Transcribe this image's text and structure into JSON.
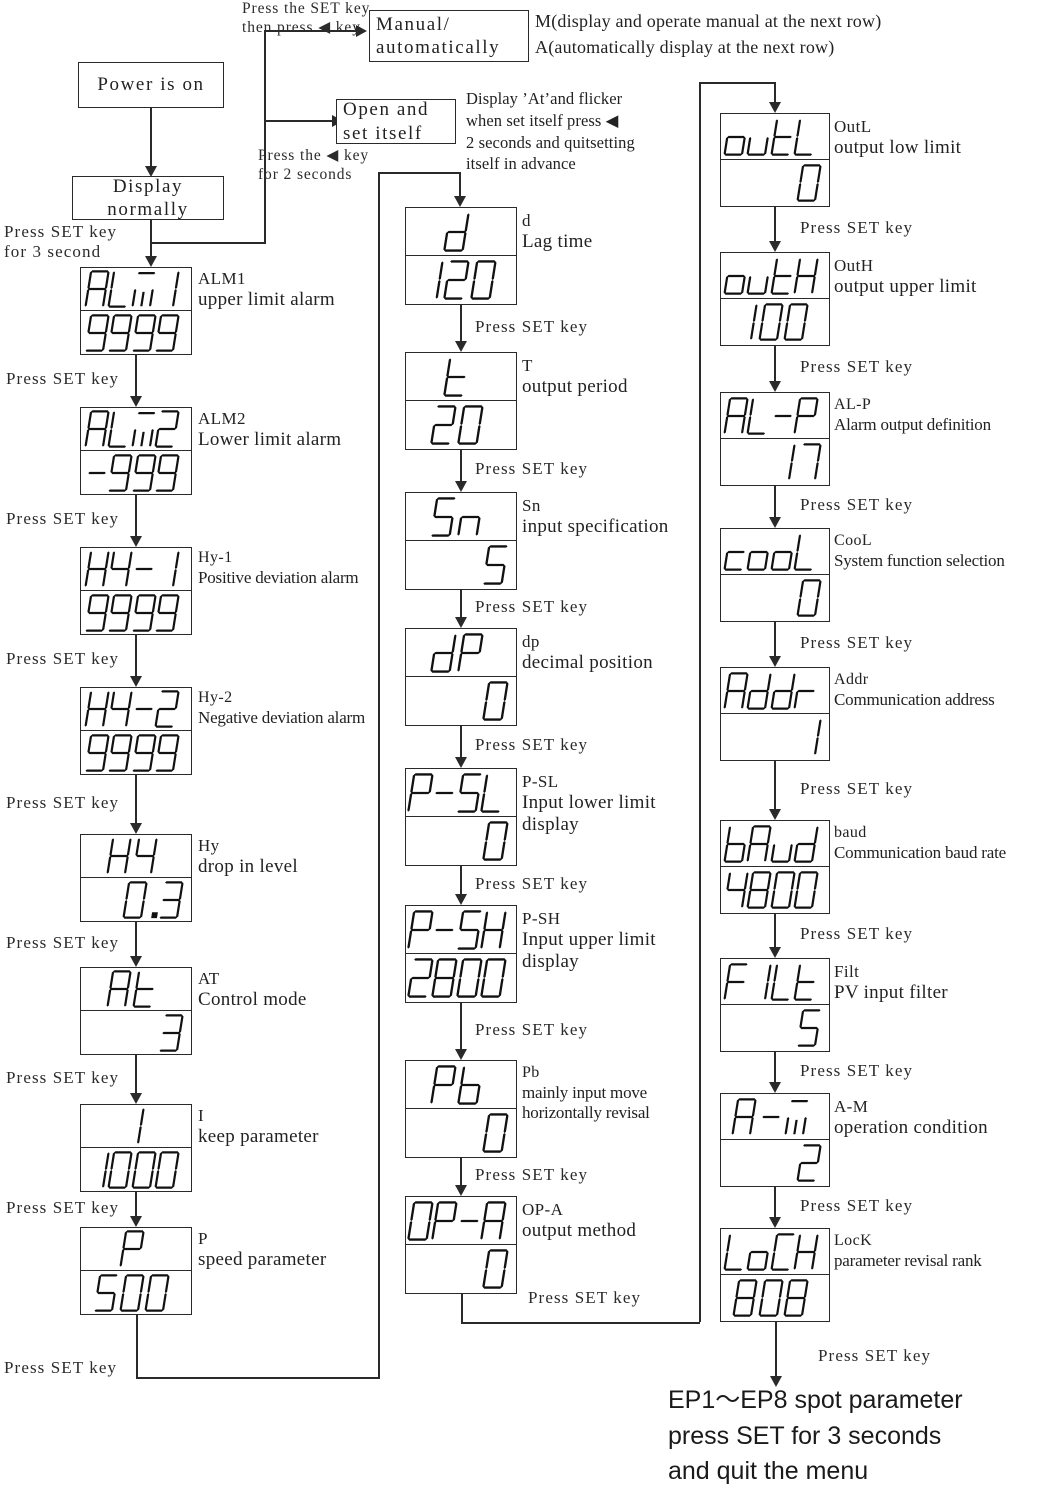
{
  "flow": {
    "start_box": "Power is on",
    "normal_box": "Display normally",
    "manual_box": "Manual/\nautomatically",
    "selfset_box": "Open and\nset itself",
    "manual_caption": "Press the SET key\nthen press ◀ key",
    "manual_legend": "M(display and operate manual at the next row)\nA(automatically display at the next row)",
    "selfset_caption": "Press the ◀ key\nfor 2 seconds",
    "selfset_legend": "Display ’At’and flicker\nwhen set itself press ◀\n2 seconds and quitsetting\nitself in advance",
    "set3s_caption": "Press SET key\nfor 3 second",
    "press_set": "Press SET key",
    "end_note": "EP1～EP8 spot parameter\npress SET for 3 seconds\nand quit the menu",
    "end_prefix": "EP1～"
  },
  "columns": [
    {
      "name": "left-column",
      "params": [
        {
          "code": "ALM1",
          "display": "ALM1",
          "value": "9999",
          "label": "ALM1",
          "desc": "upper limit alarm",
          "align": "center"
        },
        {
          "code": "ALM2",
          "display": "ALM2",
          "value": "-999",
          "label": "ALM2",
          "desc": "Lower limit alarm",
          "align": "center"
        },
        {
          "code": "HY-1",
          "display": "HY-1",
          "value": "9999",
          "label": "Hy-1",
          "desc": "Positive deviation alarm",
          "align": "center"
        },
        {
          "code": "HY-2",
          "display": "HY-2",
          "value": "9999",
          "label": "Hy-2",
          "desc": "Negative deviation alarm",
          "align": "center"
        },
        {
          "code": "HY",
          "display": "HY",
          "value": "0.3",
          "label": "Hy",
          "desc": "drop in level",
          "align": "right"
        },
        {
          "code": "At",
          "display": "At",
          "value": "3",
          "label": "AT",
          "desc": "Control mode",
          "align": "right"
        },
        {
          "code": "I",
          "display": "I",
          "value": "1000",
          "label": "I",
          "desc": "keep parameter",
          "align": "center"
        },
        {
          "code": "P",
          "display": "P",
          "value": "500",
          "label": "P",
          "desc": "speed parameter",
          "align": "center"
        }
      ]
    },
    {
      "name": "middle-column",
      "params": [
        {
          "code": "d",
          "display": "d",
          "value": "120",
          "label": "d",
          "desc": "Lag time",
          "align": "center"
        },
        {
          "code": "t",
          "display": "t",
          "value": "20",
          "label": "T",
          "desc": "output period",
          "align": "center"
        },
        {
          "code": "Sn",
          "display": "Sn",
          "value": "5",
          "label": "Sn",
          "desc": "input specification",
          "align": "right"
        },
        {
          "code": "dP",
          "display": "dP",
          "value": "0",
          "label": "dp",
          "desc": "decimal position",
          "align": "right"
        },
        {
          "code": "P-SL",
          "display": "P-SL",
          "value": "0",
          "label": "P-SL",
          "desc": "Input lower limit\ndisplay",
          "align": "right"
        },
        {
          "code": "P-SH",
          "display": "P-SH",
          "value": "2800",
          "label": "P-SH",
          "desc": "Input upper limit\n display",
          "align": "center"
        },
        {
          "code": "Pb",
          "display": "Pb",
          "value": "0",
          "label": "Pb",
          "desc": "mainly input move\nhorizontally revisal",
          "align": "right"
        },
        {
          "code": "OP-A",
          "display": "OP-A",
          "value": "0",
          "label": "OP-A",
          "desc": "output method",
          "align": "right"
        }
      ]
    },
    {
      "name": "right-column",
      "params": [
        {
          "code": "outL",
          "display": "outL",
          "value": "0",
          "label": "OutL",
          "desc": "output low limit",
          "align": "right"
        },
        {
          "code": "outH",
          "display": "outH",
          "value": "100",
          "label": "OutH",
          "desc": "output upper limit",
          "align": "center"
        },
        {
          "code": "AL-P",
          "display": "AL-P",
          "value": "17",
          "label": "AL-P",
          "desc": "Alarm output definition",
          "align": "right"
        },
        {
          "code": "cooL",
          "display": "cooL",
          "value": "0",
          "label": "CooL",
          "desc": "System function selection",
          "align": "right"
        },
        {
          "code": "Addr",
          "display": "Addr",
          "value": "1",
          "label": "Addr",
          "desc": "Communication address",
          "align": "right"
        },
        {
          "code": "bAud",
          "display": "bAud",
          "value": "4800",
          "label": "baud",
          "desc": "Communication baud rate",
          "align": "center"
        },
        {
          "code": "FILt",
          "display": "FILt",
          "value": "5",
          "label": "Filt",
          "desc": "PV input filter",
          "align": "right"
        },
        {
          "code": "A-M",
          "display": "A-M",
          "value": "2",
          "label": "A-M",
          "desc": "operation condition",
          "align": "right"
        },
        {
          "code": "LoCK",
          "display": "LoCK",
          "value": "808",
          "label": "LocK",
          "desc": "parameter revisal rank",
          "align": "center"
        }
      ]
    }
  ],
  "colors": {
    "line": "#2a2a2a",
    "text": "#1a1a1a",
    "background": "#ffffff"
  }
}
